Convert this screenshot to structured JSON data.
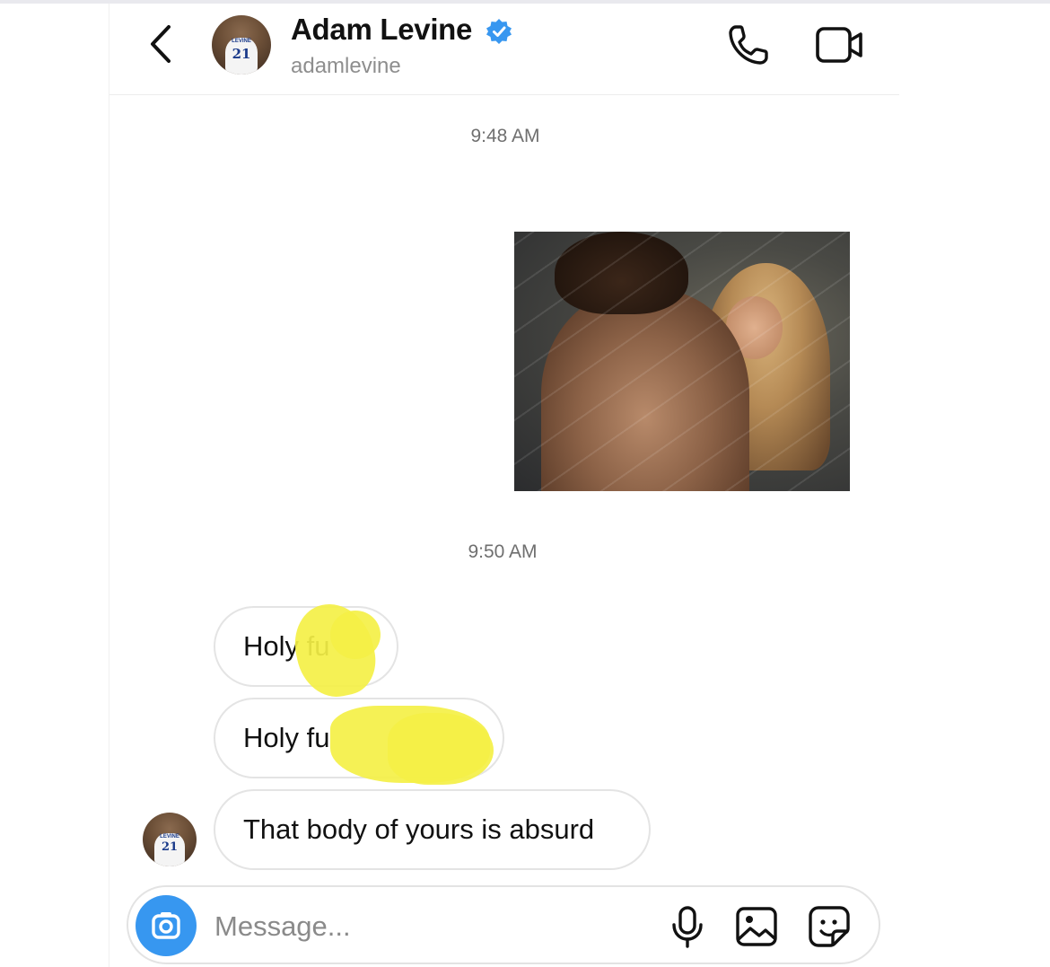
{
  "header": {
    "name": "Adam Levine",
    "username": "adamlevine",
    "avatar_jersey_text": "LEVINE",
    "avatar_jersey_number": "21",
    "icons": {
      "back": "chevron-left-icon",
      "verified": "verified-badge-icon",
      "call": "phone-icon",
      "video": "video-camera-icon"
    },
    "colors": {
      "verified": "#3897f0"
    }
  },
  "messages": {
    "timestamp_1": "9:48 AM",
    "timestamp_2": "9:50 AM",
    "bubble_1": "Holy fu",
    "bubble_2": "Holy fu",
    "bubble_3": "That body of yours is absurd",
    "redaction_color": "#f4f046"
  },
  "composer": {
    "placeholder": "Message...",
    "value": "",
    "accent": "#3797f0",
    "icons": {
      "camera": "camera-icon",
      "mic": "microphone-icon",
      "gallery": "image-icon",
      "sticker": "sticker-icon"
    }
  }
}
